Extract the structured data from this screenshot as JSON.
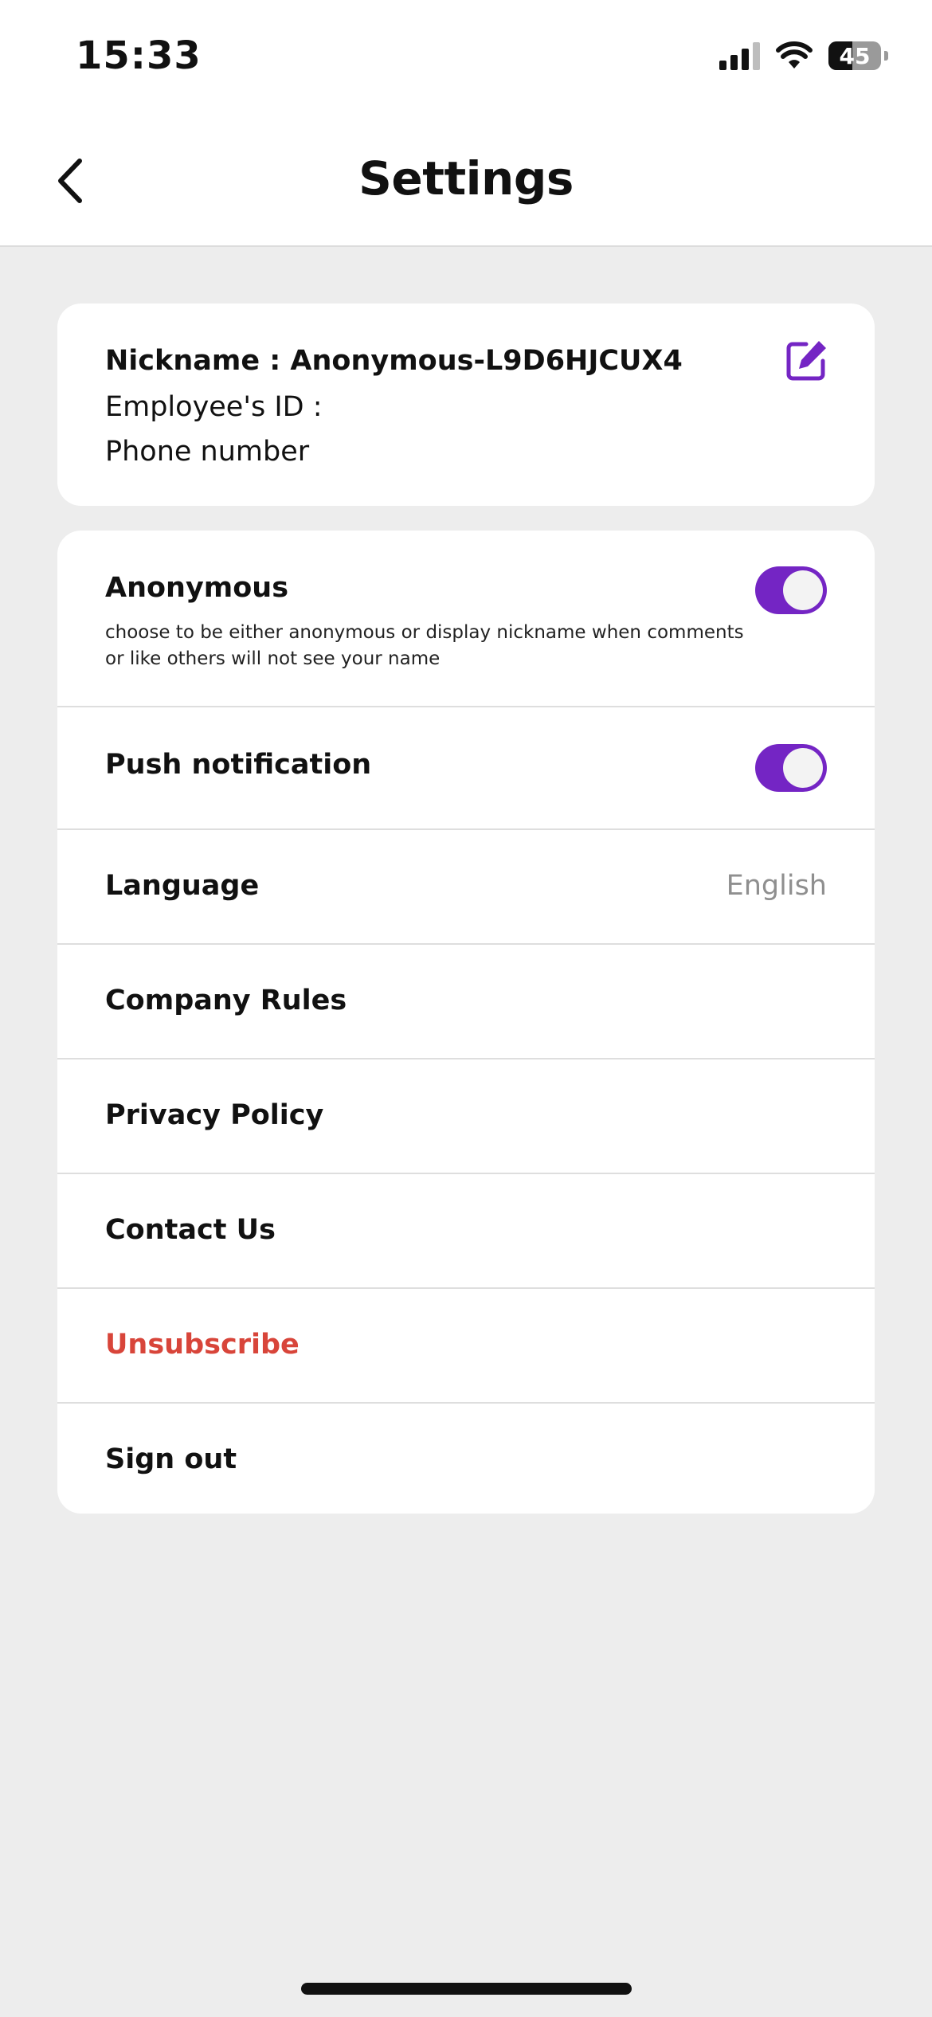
{
  "status_bar": {
    "time": "15:33",
    "battery_level": "45",
    "battery_fraction": 0.45,
    "icons": [
      "signal-icon",
      "wifi-icon",
      "battery-icon"
    ]
  },
  "header": {
    "title": "Settings",
    "back_icon": "chevron-left-icon"
  },
  "profile": {
    "nickname": "Nickname : Anonymous-L9D6HJCUX4",
    "employee_id": "Employee's ID :",
    "phone": "Phone number",
    "edit_icon": "edit-icon"
  },
  "settings": {
    "anonymous": {
      "label": "Anonymous",
      "description": "choose to be either anonymous or display nickname when comments or like others will not see your name",
      "enabled": true
    },
    "push_notification": {
      "label": "Push notification",
      "enabled": true
    },
    "language": {
      "label": "Language",
      "value": "English"
    },
    "company_rules": {
      "label": "Company Rules"
    },
    "privacy_policy": {
      "label": "Privacy Policy"
    },
    "contact_us": {
      "label": "Contact Us"
    },
    "unsubscribe": {
      "label": "Unsubscribe"
    },
    "sign_out": {
      "label": "Sign out"
    }
  },
  "colors": {
    "accent": "#7425c4",
    "danger": "#d8453a",
    "background": "#ededed",
    "card": "#ffffff",
    "muted_text": "#8f8f8f"
  }
}
